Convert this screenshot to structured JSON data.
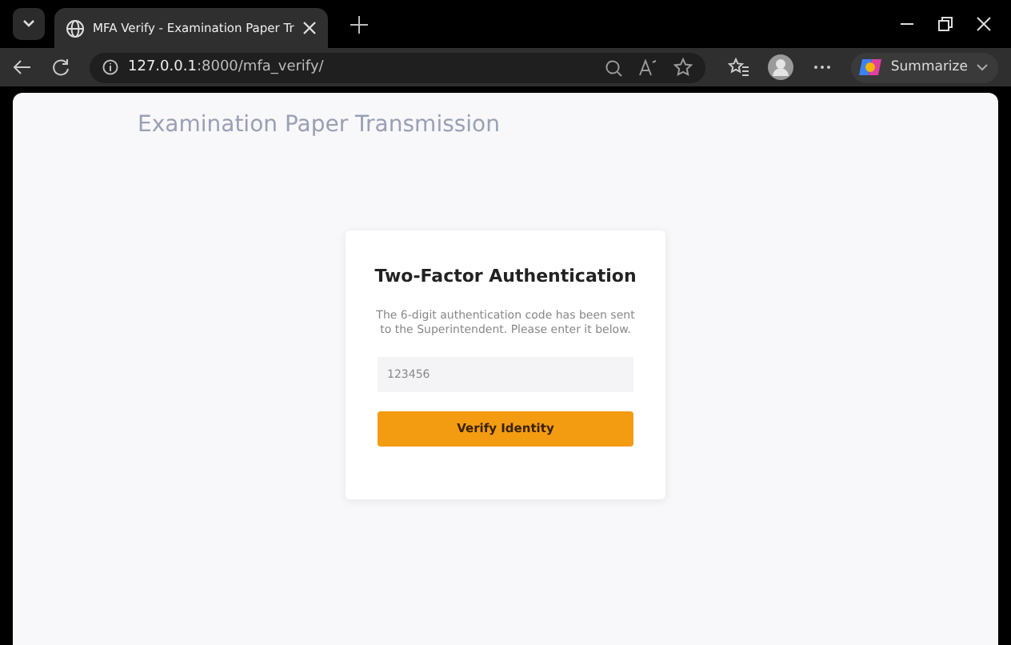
{
  "browser": {
    "tab_title": "MFA Verify - Examination Paper Tr",
    "url_host": "127.0.0.1",
    "url_rest": ":8000/mfa_verify/",
    "summarize": "Summarize"
  },
  "page": {
    "heading": "Examination Paper Transmission"
  },
  "card": {
    "title": "Two-Factor Authentication",
    "message": "The 6-digit authentication code has been sent to the Superintendent. Please enter it below.",
    "code_field": {
      "placeholder": "123456"
    },
    "button": "Verify Identity"
  }
}
